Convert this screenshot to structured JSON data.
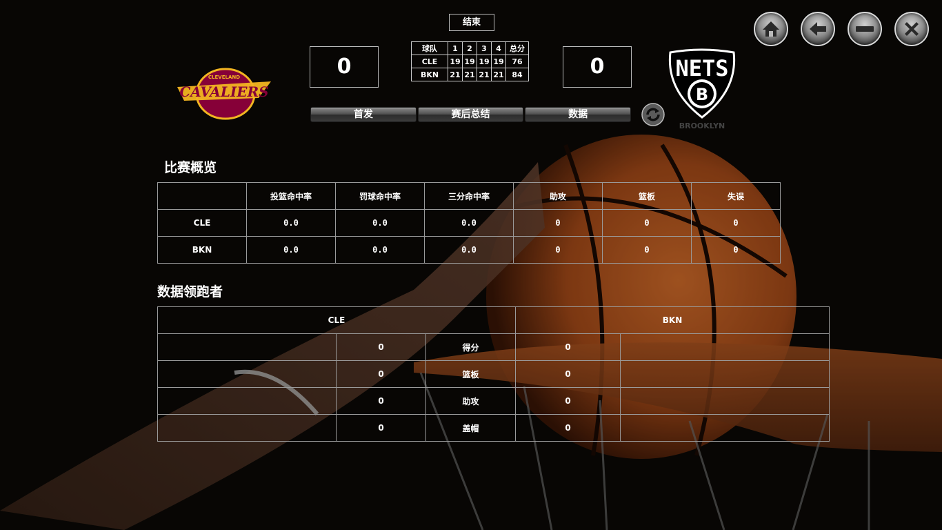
{
  "header": {
    "game_status": "结束",
    "home_score": "0",
    "away_score": "0",
    "away_logo_text": "NETS",
    "away_logo_badge": "B",
    "away_logo_sub": "BROOKLYN",
    "home_logo_text": "CAVALIERS",
    "home_logo_sub": "CLEVELAND"
  },
  "quarters": {
    "headers": [
      "球队",
      "1",
      "2",
      "3",
      "4",
      "总分"
    ],
    "rows": [
      [
        "CLE",
        "19",
        "19",
        "19",
        "19",
        "76"
      ],
      [
        "BKN",
        "21",
        "21",
        "21",
        "21",
        "84"
      ]
    ]
  },
  "tabs": [
    "首发",
    "赛后总结",
    "数据"
  ],
  "window_controls": [
    "home-icon",
    "back-arrow-icon",
    "minimize-icon",
    "close-icon"
  ],
  "overview": {
    "title": "比赛概览",
    "headers": [
      "",
      "投篮命中率",
      "罚球命中率",
      "三分命中率",
      "助攻",
      "篮板",
      "失误"
    ],
    "rows": [
      [
        "CLE",
        "0.0",
        "0.0",
        "0.0",
        "0",
        "0",
        "0"
      ],
      [
        "BKN",
        "0.0",
        "0.0",
        "0.0",
        "0",
        "0",
        "0"
      ]
    ]
  },
  "leaders": {
    "title": "数据领跑者",
    "teams": [
      "CLE",
      "BKN"
    ],
    "rows": [
      {
        "cle_player": "",
        "cle_value": "0",
        "category": "得分",
        "bkn_value": "0",
        "bkn_player": ""
      },
      {
        "cle_player": "",
        "cle_value": "0",
        "category": "篮板",
        "bkn_value": "0",
        "bkn_player": ""
      },
      {
        "cle_player": "",
        "cle_value": "0",
        "category": "助攻",
        "bkn_value": "0",
        "bkn_player": ""
      },
      {
        "cle_player": "",
        "cle_value": "0",
        "category": "盖帽",
        "bkn_value": "0",
        "bkn_player": ""
      }
    ]
  },
  "colors": {
    "background": "#0b0906",
    "ball": "#b8551f",
    "cavs_wine": "#860038",
    "cavs_gold": "#f2b521",
    "nets_black": "#000000"
  }
}
